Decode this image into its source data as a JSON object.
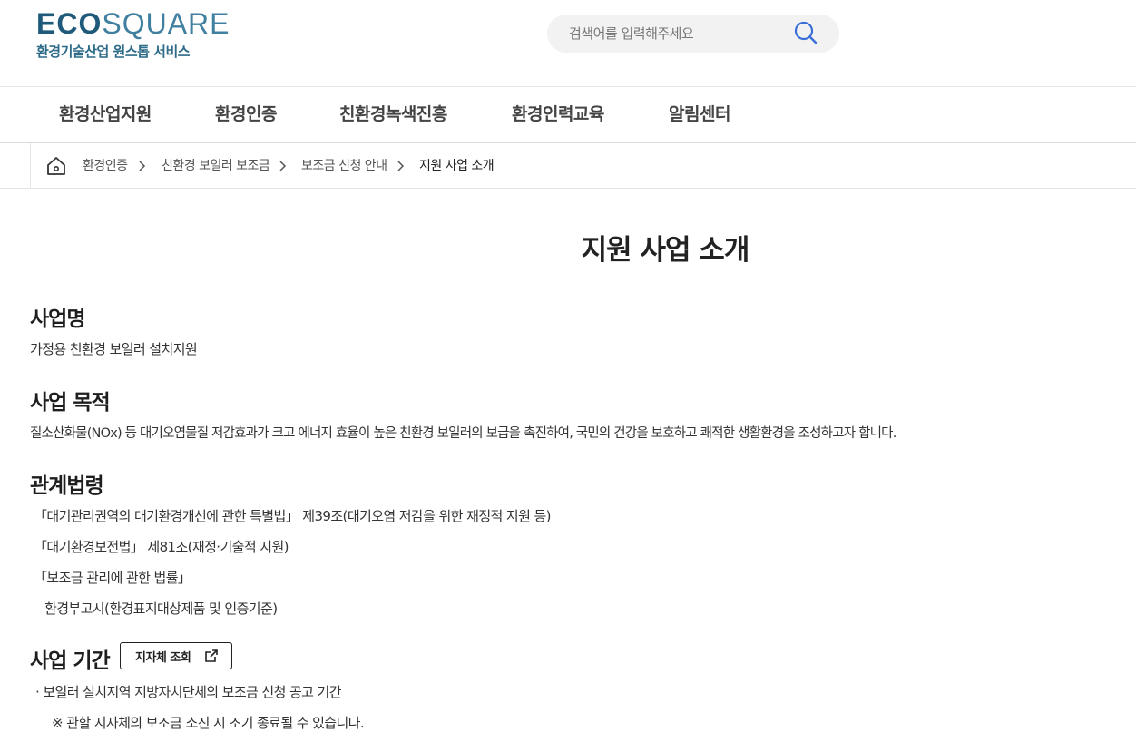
{
  "logo": {
    "eco": "ECO",
    "square": "SQUARE",
    "subtitle": "환경기술산업 원스톱 서비스"
  },
  "search": {
    "placeholder": "검색어를 입력해주세요",
    "icon": "search-icon"
  },
  "nav": {
    "items": [
      "환경산업지원",
      "환경인증",
      "친환경녹색진흥",
      "환경인력교육",
      "알림센터"
    ]
  },
  "breadcrumb": {
    "home_icon": "home-icon",
    "items": [
      "환경인증",
      "친환경 보일러 보조금",
      "보조금 신청 안내",
      "지원 사업 소개"
    ]
  },
  "page": {
    "title": "지원 사업 소개"
  },
  "sections": {
    "name": {
      "title": "사업명",
      "text": "가정용 친환경 보일러 설치지원"
    },
    "purpose": {
      "title": "사업 목적",
      "text": "질소산화물(NOx) 등 대기오염물질 저감효과가 크고 에너지 효율이 높은 친환경 보일러의 보급을 촉진하여, 국민의 건강을 보호하고 쾌적한 생활환경을 조성하고자 합니다."
    },
    "laws": {
      "title": "관계법령",
      "items": [
        "「대기관리권역의 대기환경개선에 관한 특별법」 제39조(대기오염 저감을 위한 재정적 지원 등)",
        "「대기환경보전법」 제81조(재정·기술적 지원)",
        "「보조금 관리에 관한 법률」",
        "환경부고시(환경표지대상제품 및 인증기준)"
      ]
    },
    "period": {
      "title": "사업 기간",
      "button_label": "지자체 조회",
      "button_icon": "external-link-icon",
      "text": "· 보일러 설치지역 지방자치단체의 보조금 신청 공고 기간",
      "note": "※ 관할 지자체의 보조금 소진 시 조기 종료될 수 있습니다."
    }
  }
}
